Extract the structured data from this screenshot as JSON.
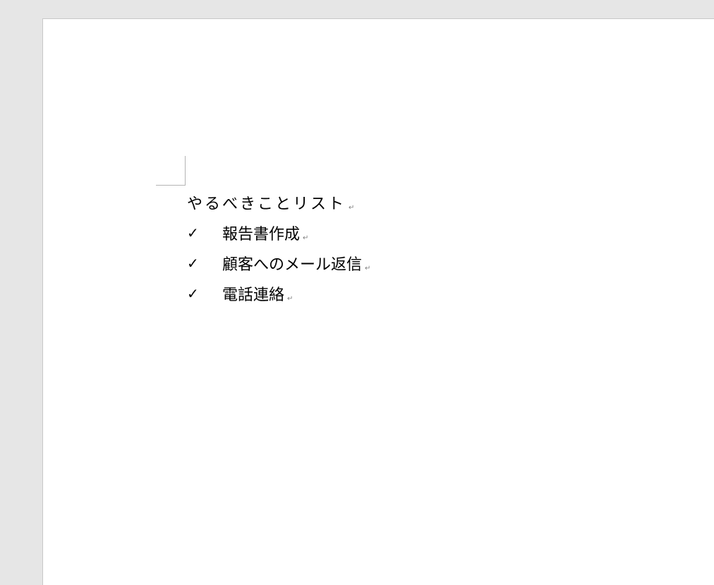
{
  "document": {
    "title": "やるべきことリスト",
    "paragraph_mark": "↵",
    "bullet": "✓",
    "items": [
      {
        "text": "報告書作成"
      },
      {
        "text": "顧客へのメール返信"
      },
      {
        "text": "電話連絡"
      }
    ]
  }
}
